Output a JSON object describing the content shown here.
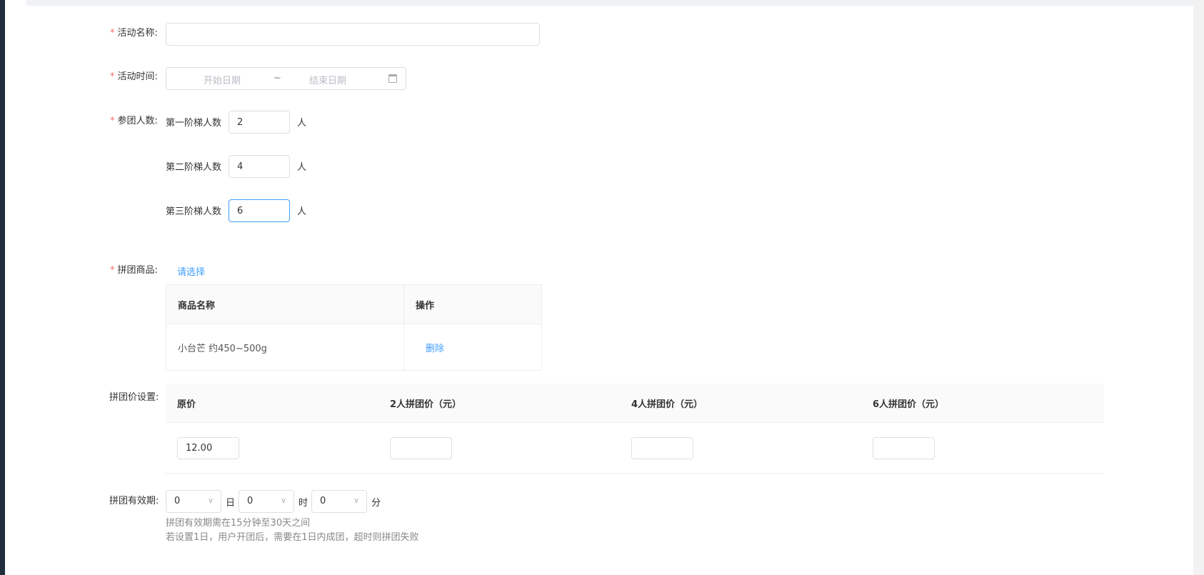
{
  "form": {
    "name": {
      "label": "活动名称:",
      "value": "",
      "placeholder": ""
    },
    "time": {
      "label": "活动时间:",
      "start_placeholder": "开始日期",
      "separator": "~",
      "end_placeholder": "结束日期",
      "icon": "calendar-icon"
    },
    "group_size": {
      "label": "参团人数:",
      "tiers": [
        {
          "label": "第一阶梯人数",
          "value": "2",
          "unit": "人"
        },
        {
          "label": "第二阶梯人数",
          "value": "4",
          "unit": "人"
        },
        {
          "label": "第三阶梯人数",
          "value": "6",
          "unit": "人"
        }
      ]
    },
    "goods": {
      "label": "拼团商品:",
      "select_link": "请选择",
      "columns": [
        "商品名称",
        "操作"
      ],
      "rows": [
        {
          "name": "小台芒 约450~500g",
          "action": "删除"
        }
      ]
    },
    "price": {
      "label": "拼团价设置:",
      "columns": [
        "原价",
        "2人拼团价（元）",
        "4人拼团价（元）",
        "6人拼团价（元）"
      ],
      "values": [
        "12.00",
        "",
        "",
        ""
      ]
    },
    "validity": {
      "label": "拼团有效期:",
      "day": {
        "value": "0",
        "unit": "日"
      },
      "hour": {
        "value": "0",
        "unit": "时"
      },
      "minute": {
        "value": "0",
        "unit": "分"
      },
      "hints": [
        "拼团有效期需在15分钟至30天之间",
        "若设置1日，用户开团后，需要在1日内成团，超时则拼团失败"
      ]
    }
  },
  "colors": {
    "required": "#f56c6c",
    "link": "#409eff",
    "focus": "#409eff",
    "border": "#dcdfe6"
  }
}
